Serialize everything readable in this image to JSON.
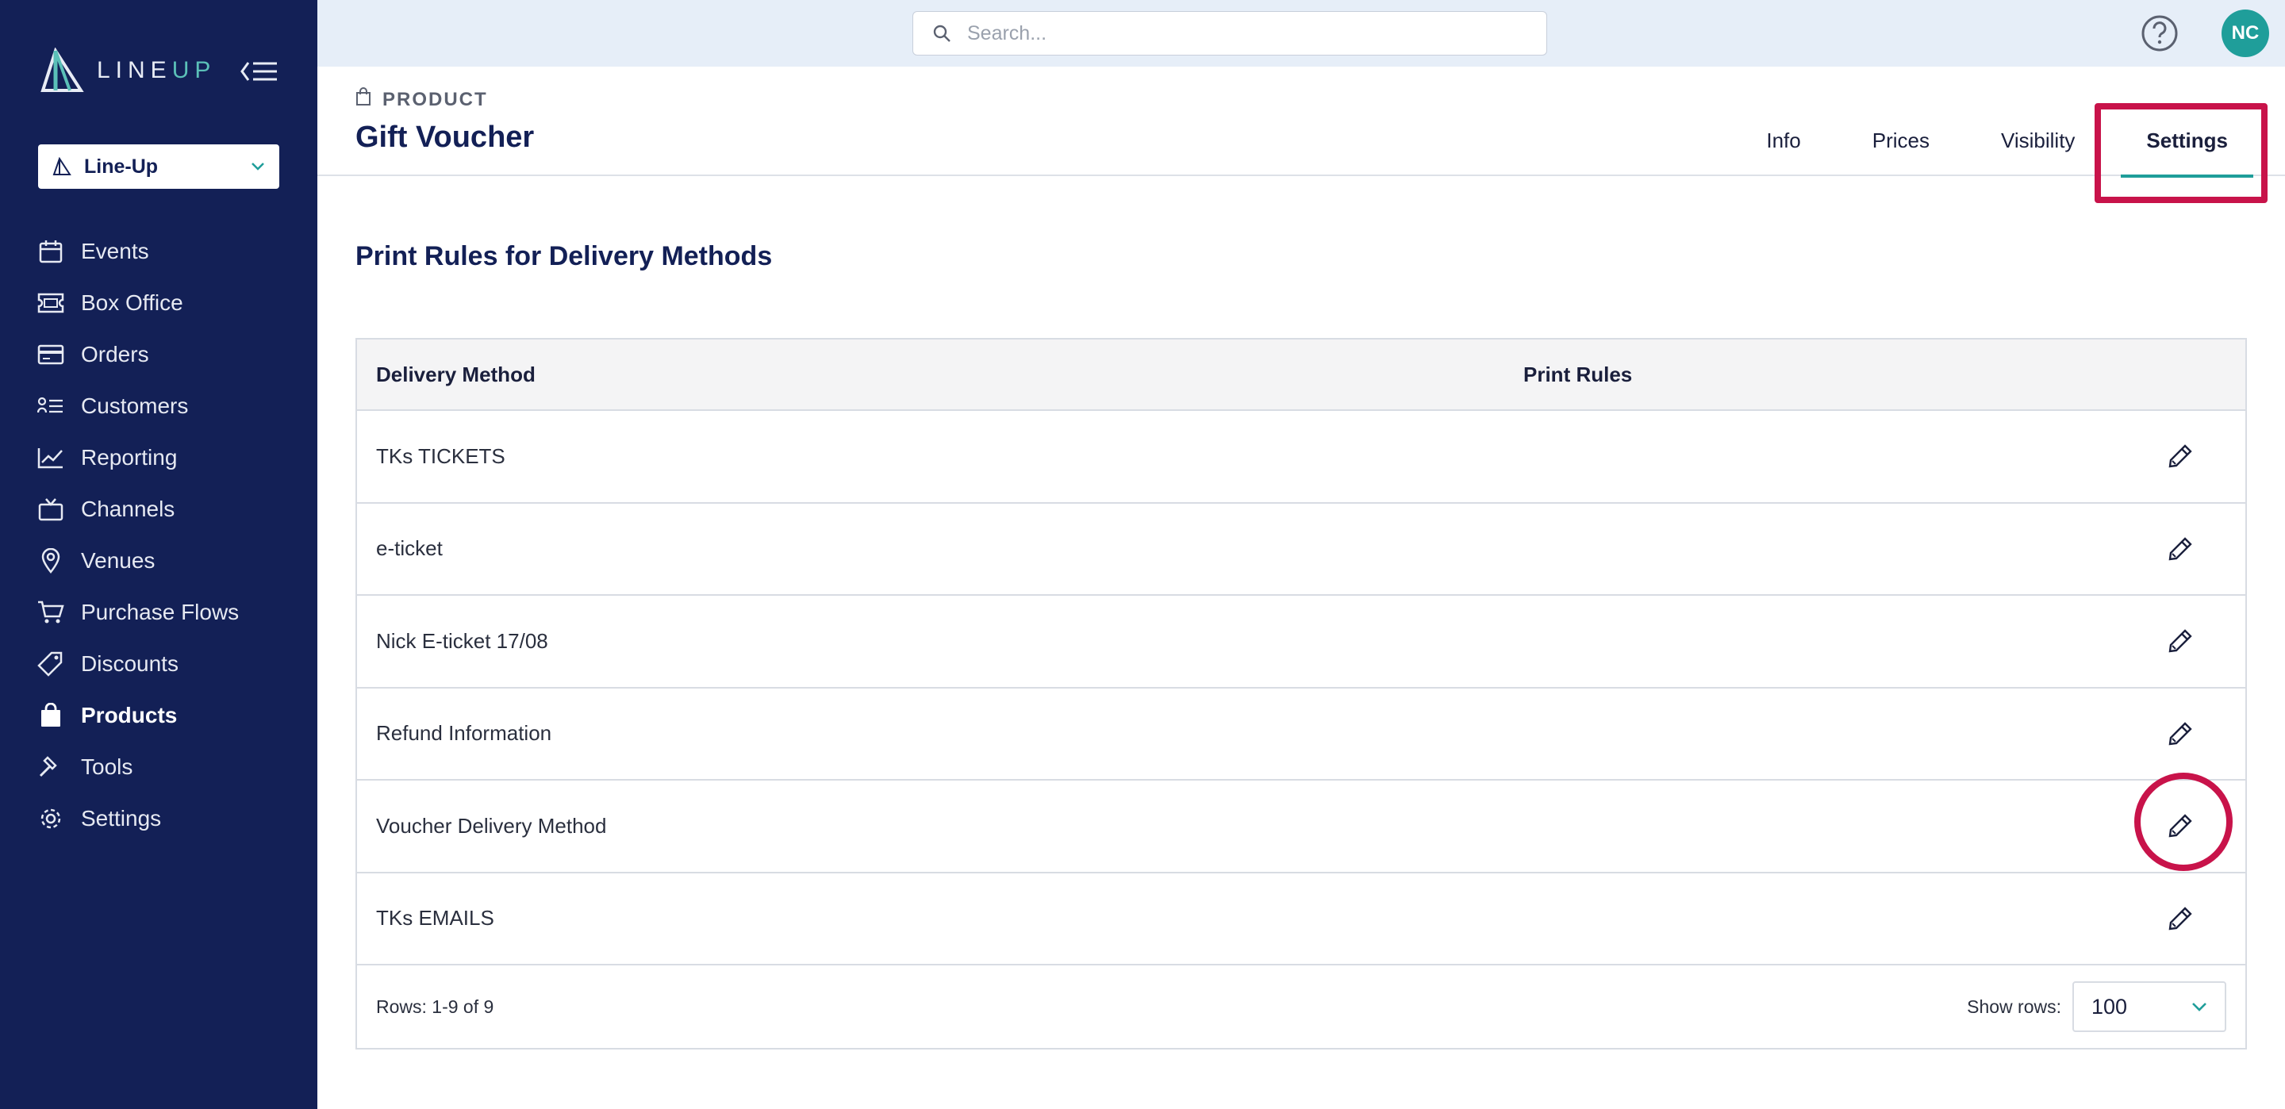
{
  "app": {
    "logo_text_a": "LINE",
    "logo_text_b": "UP",
    "org_selector": "Line-Up"
  },
  "sidebar": {
    "items": [
      {
        "label": "Events",
        "icon": "calendar-icon",
        "active": false
      },
      {
        "label": "Box Office",
        "icon": "ticket-icon",
        "active": false
      },
      {
        "label": "Orders",
        "icon": "credit-card-icon",
        "active": false
      },
      {
        "label": "Customers",
        "icon": "customers-list-icon",
        "active": false
      },
      {
        "label": "Reporting",
        "icon": "trend-chart-icon",
        "active": false
      },
      {
        "label": "Channels",
        "icon": "tv-icon",
        "active": false
      },
      {
        "label": "Venues",
        "icon": "map-pin-icon",
        "active": false
      },
      {
        "label": "Purchase Flows",
        "icon": "cart-icon",
        "active": false
      },
      {
        "label": "Discounts",
        "icon": "tags-icon",
        "active": false
      },
      {
        "label": "Products",
        "icon": "shopping-bag-icon",
        "active": true
      },
      {
        "label": "Tools",
        "icon": "hammer-icon",
        "active": false
      },
      {
        "label": "Settings",
        "icon": "gear-icon",
        "active": false
      }
    ]
  },
  "topbar": {
    "search_placeholder": "Search...",
    "avatar_initials": "NC"
  },
  "header": {
    "breadcrumb": "PRODUCT",
    "title": "Gift Voucher",
    "tabs": [
      {
        "label": "Info",
        "active": false
      },
      {
        "label": "Prices",
        "active": false
      },
      {
        "label": "Visibility",
        "active": false
      },
      {
        "label": "Settings",
        "active": true
      }
    ]
  },
  "main": {
    "section_title": "Print Rules for Delivery Methods",
    "table": {
      "columns": [
        "Delivery Method",
        "Print Rules"
      ],
      "rows": [
        {
          "name": "TKs TICKETS"
        },
        {
          "name": "e-ticket"
        },
        {
          "name": "Nick E-ticket 17/08"
        },
        {
          "name": "Refund Information"
        },
        {
          "name": "Voucher Delivery Method"
        },
        {
          "name": "TKs EMAILS"
        }
      ],
      "rows_summary": "Rows: 1-9 of 9",
      "show_rows_label": "Show rows:",
      "show_rows_value": "100"
    }
  },
  "colors": {
    "sidebar_bg": "#132056",
    "accent": "#1f9e9a",
    "highlight": "#c8134a",
    "topbar_bg": "#e6eef8"
  }
}
